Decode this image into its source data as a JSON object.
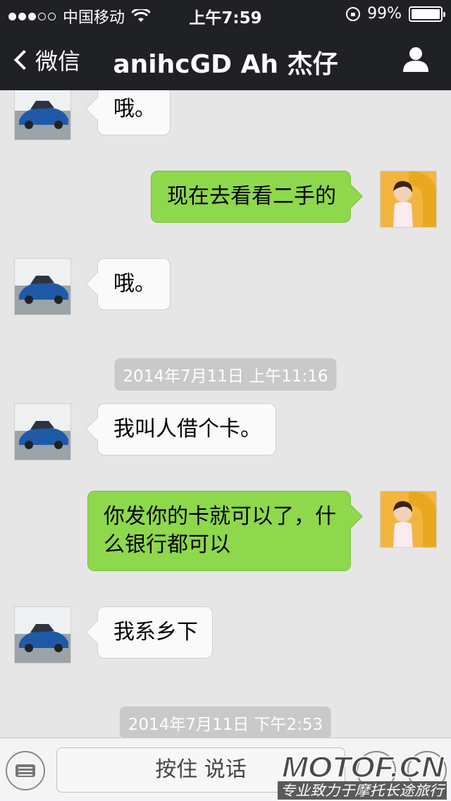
{
  "status_bar": {
    "carrier": "中国移动",
    "time": "上午7:59",
    "battery": "99%",
    "battery_level": 0.99,
    "signal_bars": 3
  },
  "nav": {
    "back_label": "微信",
    "title": "anihcGD Ah 杰仔",
    "profile_icon": "person-icon"
  },
  "messages": [
    {
      "side": "left",
      "text": "哦。"
    },
    {
      "side": "right",
      "text": "现在去看看二手的"
    },
    {
      "side": "left",
      "text": "哦。"
    },
    {
      "timestamp": "2014年7月11日 上午11:16"
    },
    {
      "side": "left",
      "text": "我叫人借个卡。"
    },
    {
      "side": "right",
      "text_line1": "你发你的卡就可以了，什",
      "text_line2": "么银行都可以"
    },
    {
      "side": "left",
      "text": "我系乡下"
    },
    {
      "timestamp": "2014年7月11日 下午2:53"
    }
  ],
  "input": {
    "hold_to_talk": "按住 说话",
    "keyboard_icon": "keyboard-icon",
    "emoji_icon": "emoji-icon",
    "plus_icon": "plus-icon"
  },
  "watermark": {
    "brand": "MOTOF.CN",
    "slogan": "专业致力于摩托长途旅行"
  },
  "colors": {
    "nav_bg": "#1f2124",
    "chat_bg": "#e6e6e6",
    "sent_bubble": "#8ed84c",
    "received_bubble": "#fafafa"
  }
}
